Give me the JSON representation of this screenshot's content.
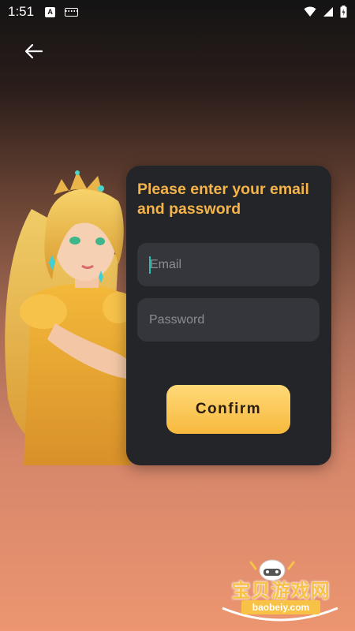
{
  "status_bar": {
    "time": "1:51",
    "icons": [
      "app-notification-icon",
      "keyboard-icon",
      "wifi-icon",
      "signal-icon",
      "battery-charging-icon"
    ]
  },
  "nav": {
    "back_icon": "back-arrow-icon"
  },
  "card": {
    "title": "Please enter your email and password",
    "email_placeholder": "Email",
    "password_placeholder": "Password",
    "confirm_label": "Confirm"
  },
  "watermark": {
    "text": "宝贝游戏网",
    "url": "baobeiy.com"
  },
  "colors": {
    "accent": "#f4b44a",
    "button": "#f7b93e",
    "card_bg": "#242529",
    "field_bg": "#34363b",
    "caret": "#27c0b3"
  }
}
